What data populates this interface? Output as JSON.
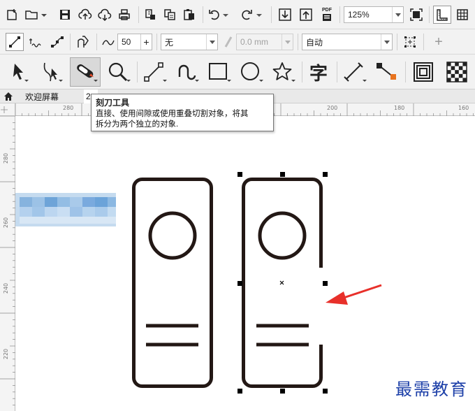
{
  "toolbar": {
    "zoom_value": "125%",
    "pdf_label": "PDF"
  },
  "property_bar": {
    "smoothing_value": "50",
    "outline_style": "无",
    "outline_width_placeholder": "0.0 mm",
    "mode_value": "自动"
  },
  "tabs": [
    {
      "label": "欢迎屏幕"
    },
    {
      "label": "2"
    }
  ],
  "tooltip": {
    "title": "刻刀工具",
    "line1": "直接、使用间隙或使用重叠切割对象，将其",
    "line2": "拆分为两个独立的对象."
  },
  "ruler": {
    "horizontal": [
      "280",
      "260",
      "240",
      "220",
      "200",
      "180",
      "160"
    ],
    "vertical": [
      "280",
      "260",
      "240",
      "220"
    ]
  },
  "colors": {
    "shape_stroke": "#231815",
    "arrow": "#e8302a",
    "watermark": "#1c3fa8",
    "knife_tool_highlight": "#d9d9d9"
  },
  "icons": {
    "knife": "knife-tool-icon",
    "zoom": "zoom-tool-icon",
    "text": "text-tool-icon"
  },
  "text_tool_glyph": "字",
  "watermark": "最需教育"
}
